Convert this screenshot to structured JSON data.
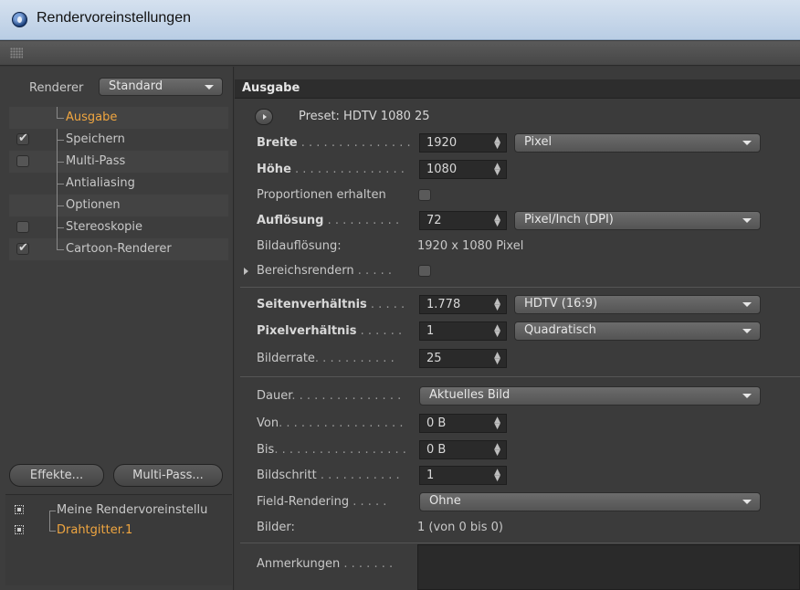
{
  "window": {
    "title": "Rendervoreinstellungen"
  },
  "left": {
    "renderer_label": "Renderer",
    "renderer_value": "Standard",
    "items": [
      {
        "label": "Ausgabe",
        "checkbox": "none",
        "active": true
      },
      {
        "label": "Speichern",
        "checkbox": "checked",
        "active": false
      },
      {
        "label": "Multi-Pass",
        "checkbox": "unchecked",
        "active": false
      },
      {
        "label": "Antialiasing",
        "checkbox": "none",
        "active": false
      },
      {
        "label": "Optionen",
        "checkbox": "none",
        "active": false
      },
      {
        "label": "Stereoskopie",
        "checkbox": "unchecked",
        "active": false
      },
      {
        "label": "Cartoon-Renderer",
        "checkbox": "checked",
        "active": false
      }
    ],
    "effects_button": "Effekte...",
    "multipass_button": "Multi-Pass...",
    "settings": [
      {
        "label": "Meine Rendervoreinstellu",
        "active": false
      },
      {
        "label": "Drahtgitter.1",
        "active": true
      }
    ]
  },
  "right": {
    "section_title": "Ausgabe",
    "preset": "Preset: HDTV 1080 25",
    "breite": {
      "label": "Breite",
      "dots": " . . . . . . . . . . . . . . .",
      "value": "1920",
      "unit": "Pixel"
    },
    "hoehe": {
      "label": "Höhe",
      "dots": " . . . . . . . . . . . . . . .",
      "value": "1080"
    },
    "proportionen": {
      "label": "Proportionen erhalten"
    },
    "aufloesung": {
      "label": "Auflösung",
      "dots": " . . . . . . . . . .",
      "value": "72",
      "unit": "Pixel/Inch (DPI)"
    },
    "bildaufloesung": {
      "label": "Bildauflösung:",
      "value": "1920 x 1080 Pixel"
    },
    "bereichsrendern": {
      "label": "Bereichsrendern",
      "dots": " . . . . ."
    },
    "seitenverhaeltnis": {
      "label": "Seitenverhältnis",
      "dots": " . . . . .",
      "value": "1.778",
      "unit": "HDTV (16:9)"
    },
    "pixelverhaeltnis": {
      "label": "Pixelverhältnis",
      "dots": " . . . . . .",
      "value": "1",
      "unit": "Quadratisch"
    },
    "bilderrate": {
      "label": "Bilderrate",
      "dots": ". . . . . . . . . . .",
      "value": "25"
    },
    "dauer": {
      "label": "Dauer",
      "dots": ". . . . . . . . . . . . . . .",
      "value": "Aktuelles Bild"
    },
    "von": {
      "label": "Von",
      "dots": ". . . . . . . . . . . . . . . . .",
      "value": "0 B"
    },
    "bis": {
      "label": "Bis",
      "dots": ". . . . . . . . . . . . . . . . . .",
      "value": "0 B"
    },
    "bildschritt": {
      "label": "Bildschritt",
      "dots": " . . . . . . . . . . .",
      "value": "1"
    },
    "field_rendering": {
      "label": "Field-Rendering",
      "dots": " . . . . .",
      "value": "Ohne"
    },
    "bilder": {
      "label": "Bilder:",
      "value": "1 (von 0 bis 0)"
    },
    "anmerkungen": {
      "label": "Anmerkungen",
      "dots": " . . . . . . ."
    }
  }
}
